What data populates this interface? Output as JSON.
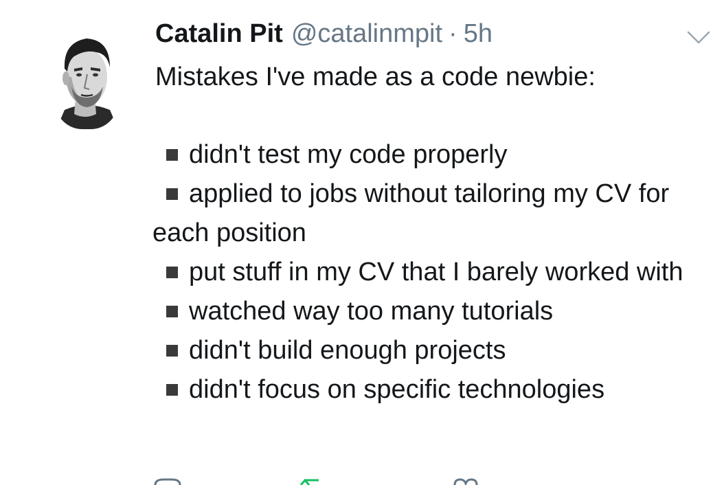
{
  "author": {
    "display_name": "Catalin Pit",
    "handle": "@catalinmpit",
    "separator": "·",
    "time_ago": "5h"
  },
  "tweet": {
    "intro": "Mistakes I've made as a code newbie:",
    "items": [
      "didn't test my code properly",
      "applied to jobs without tailoring my CV for each position",
      "put stuff in my CV that I barely worked with",
      "watched way too many tutorials",
      "didn't build enough projects",
      "didn't focus on specific technologies"
    ]
  },
  "icons": {
    "avatar": "avatar-portrait",
    "menu": "chevron-down-icon",
    "reply": "reply-icon",
    "retweet": "retweet-icon",
    "like": "like-icon"
  },
  "colors": {
    "text": "#14171a",
    "secondary": "#657786",
    "bullet": "#3a3a3a",
    "retweet_green": "#17bf63"
  }
}
